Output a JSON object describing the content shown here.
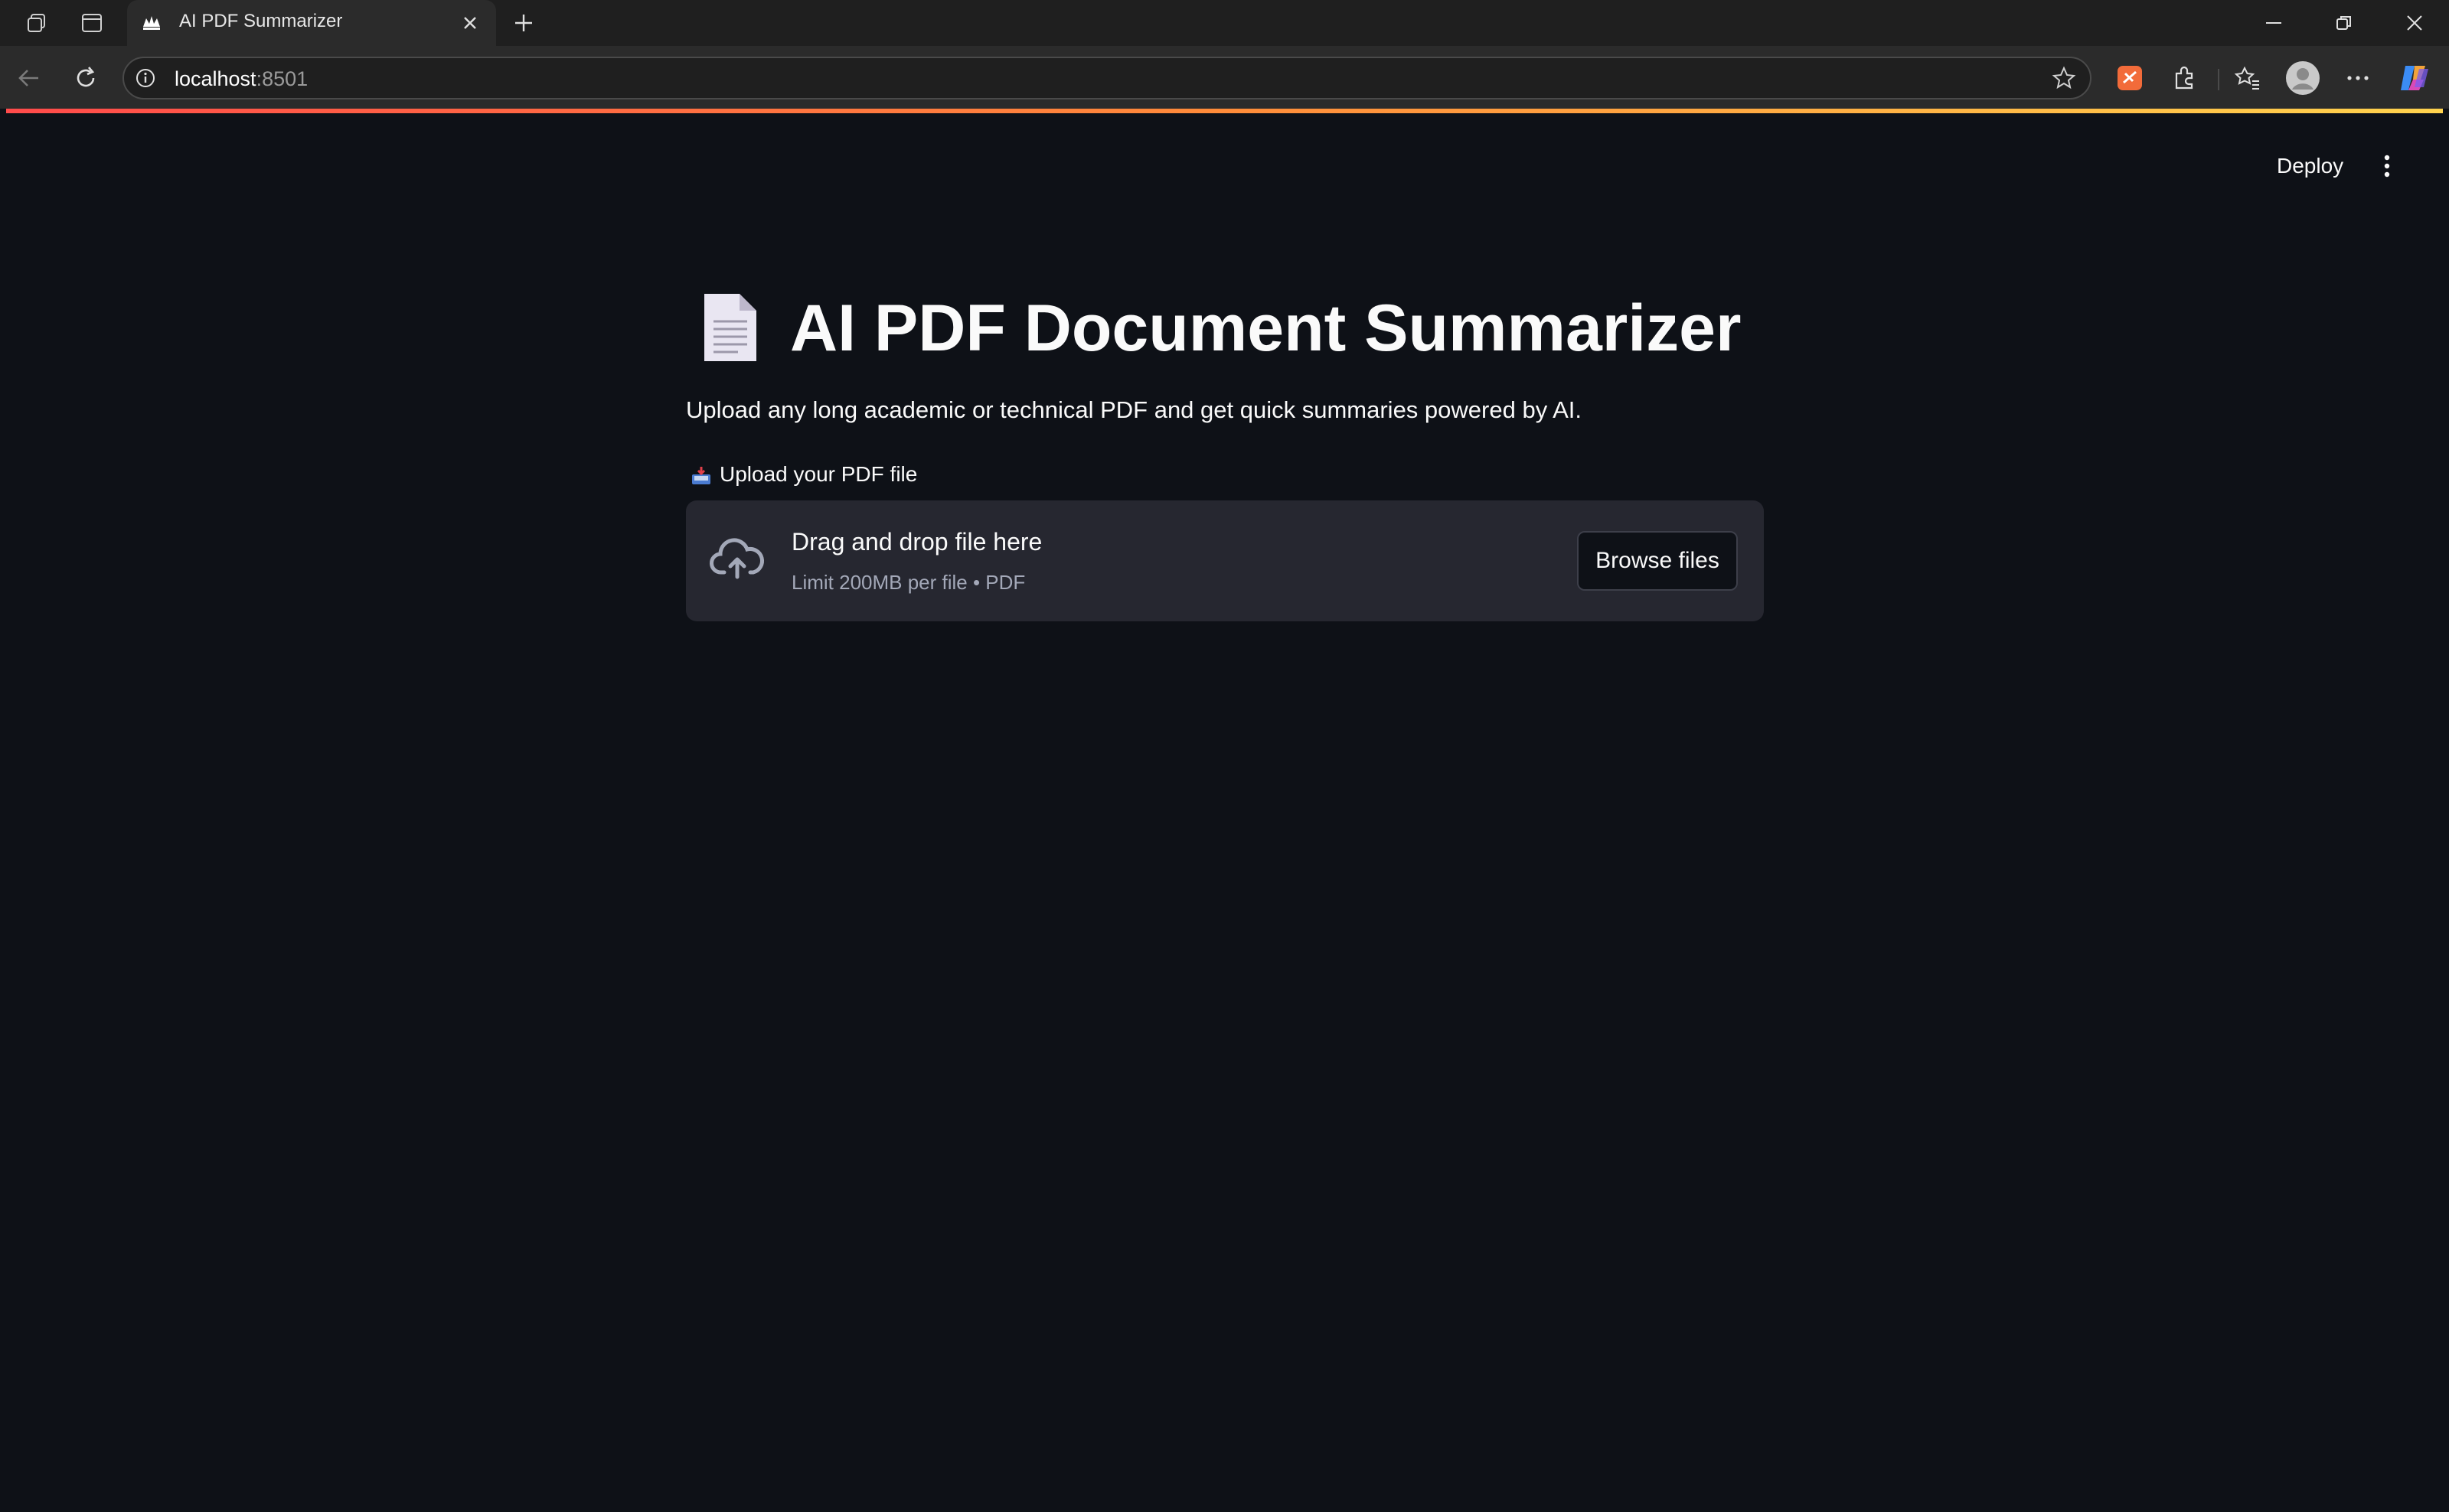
{
  "browser": {
    "tab_title": "AI PDF Summarizer",
    "url_host": "localhost",
    "url_port": ":8501",
    "icons": [
      "workspaces-icon",
      "tab-actions-icon",
      "streamlit-favicon",
      "close-tab-icon",
      "new-tab-icon",
      "minimize-icon",
      "restore-icon",
      "close-window-icon",
      "back-icon",
      "refresh-icon",
      "site-info-icon",
      "favorite-star-icon",
      "extension-icon",
      "extensions-icon",
      "favorites-icon",
      "profile-icon",
      "more-icon",
      "copilot-icon"
    ]
  },
  "header": {
    "deploy_label": "Deploy"
  },
  "main": {
    "title": "AI PDF Document Summarizer",
    "subtitle": "Upload any long academic or technical PDF and get quick summaries powered by AI.",
    "uploader_label": "Upload your PDF file",
    "dropzone_title": "Drag and drop file here",
    "dropzone_hint": "Limit 200MB per file • PDF",
    "browse_label": "Browse files"
  },
  "colors": {
    "background": "#0e1117",
    "dropzone": "#262730",
    "accent_start": "#ff4b4b",
    "accent_end": "#ffd34e"
  }
}
